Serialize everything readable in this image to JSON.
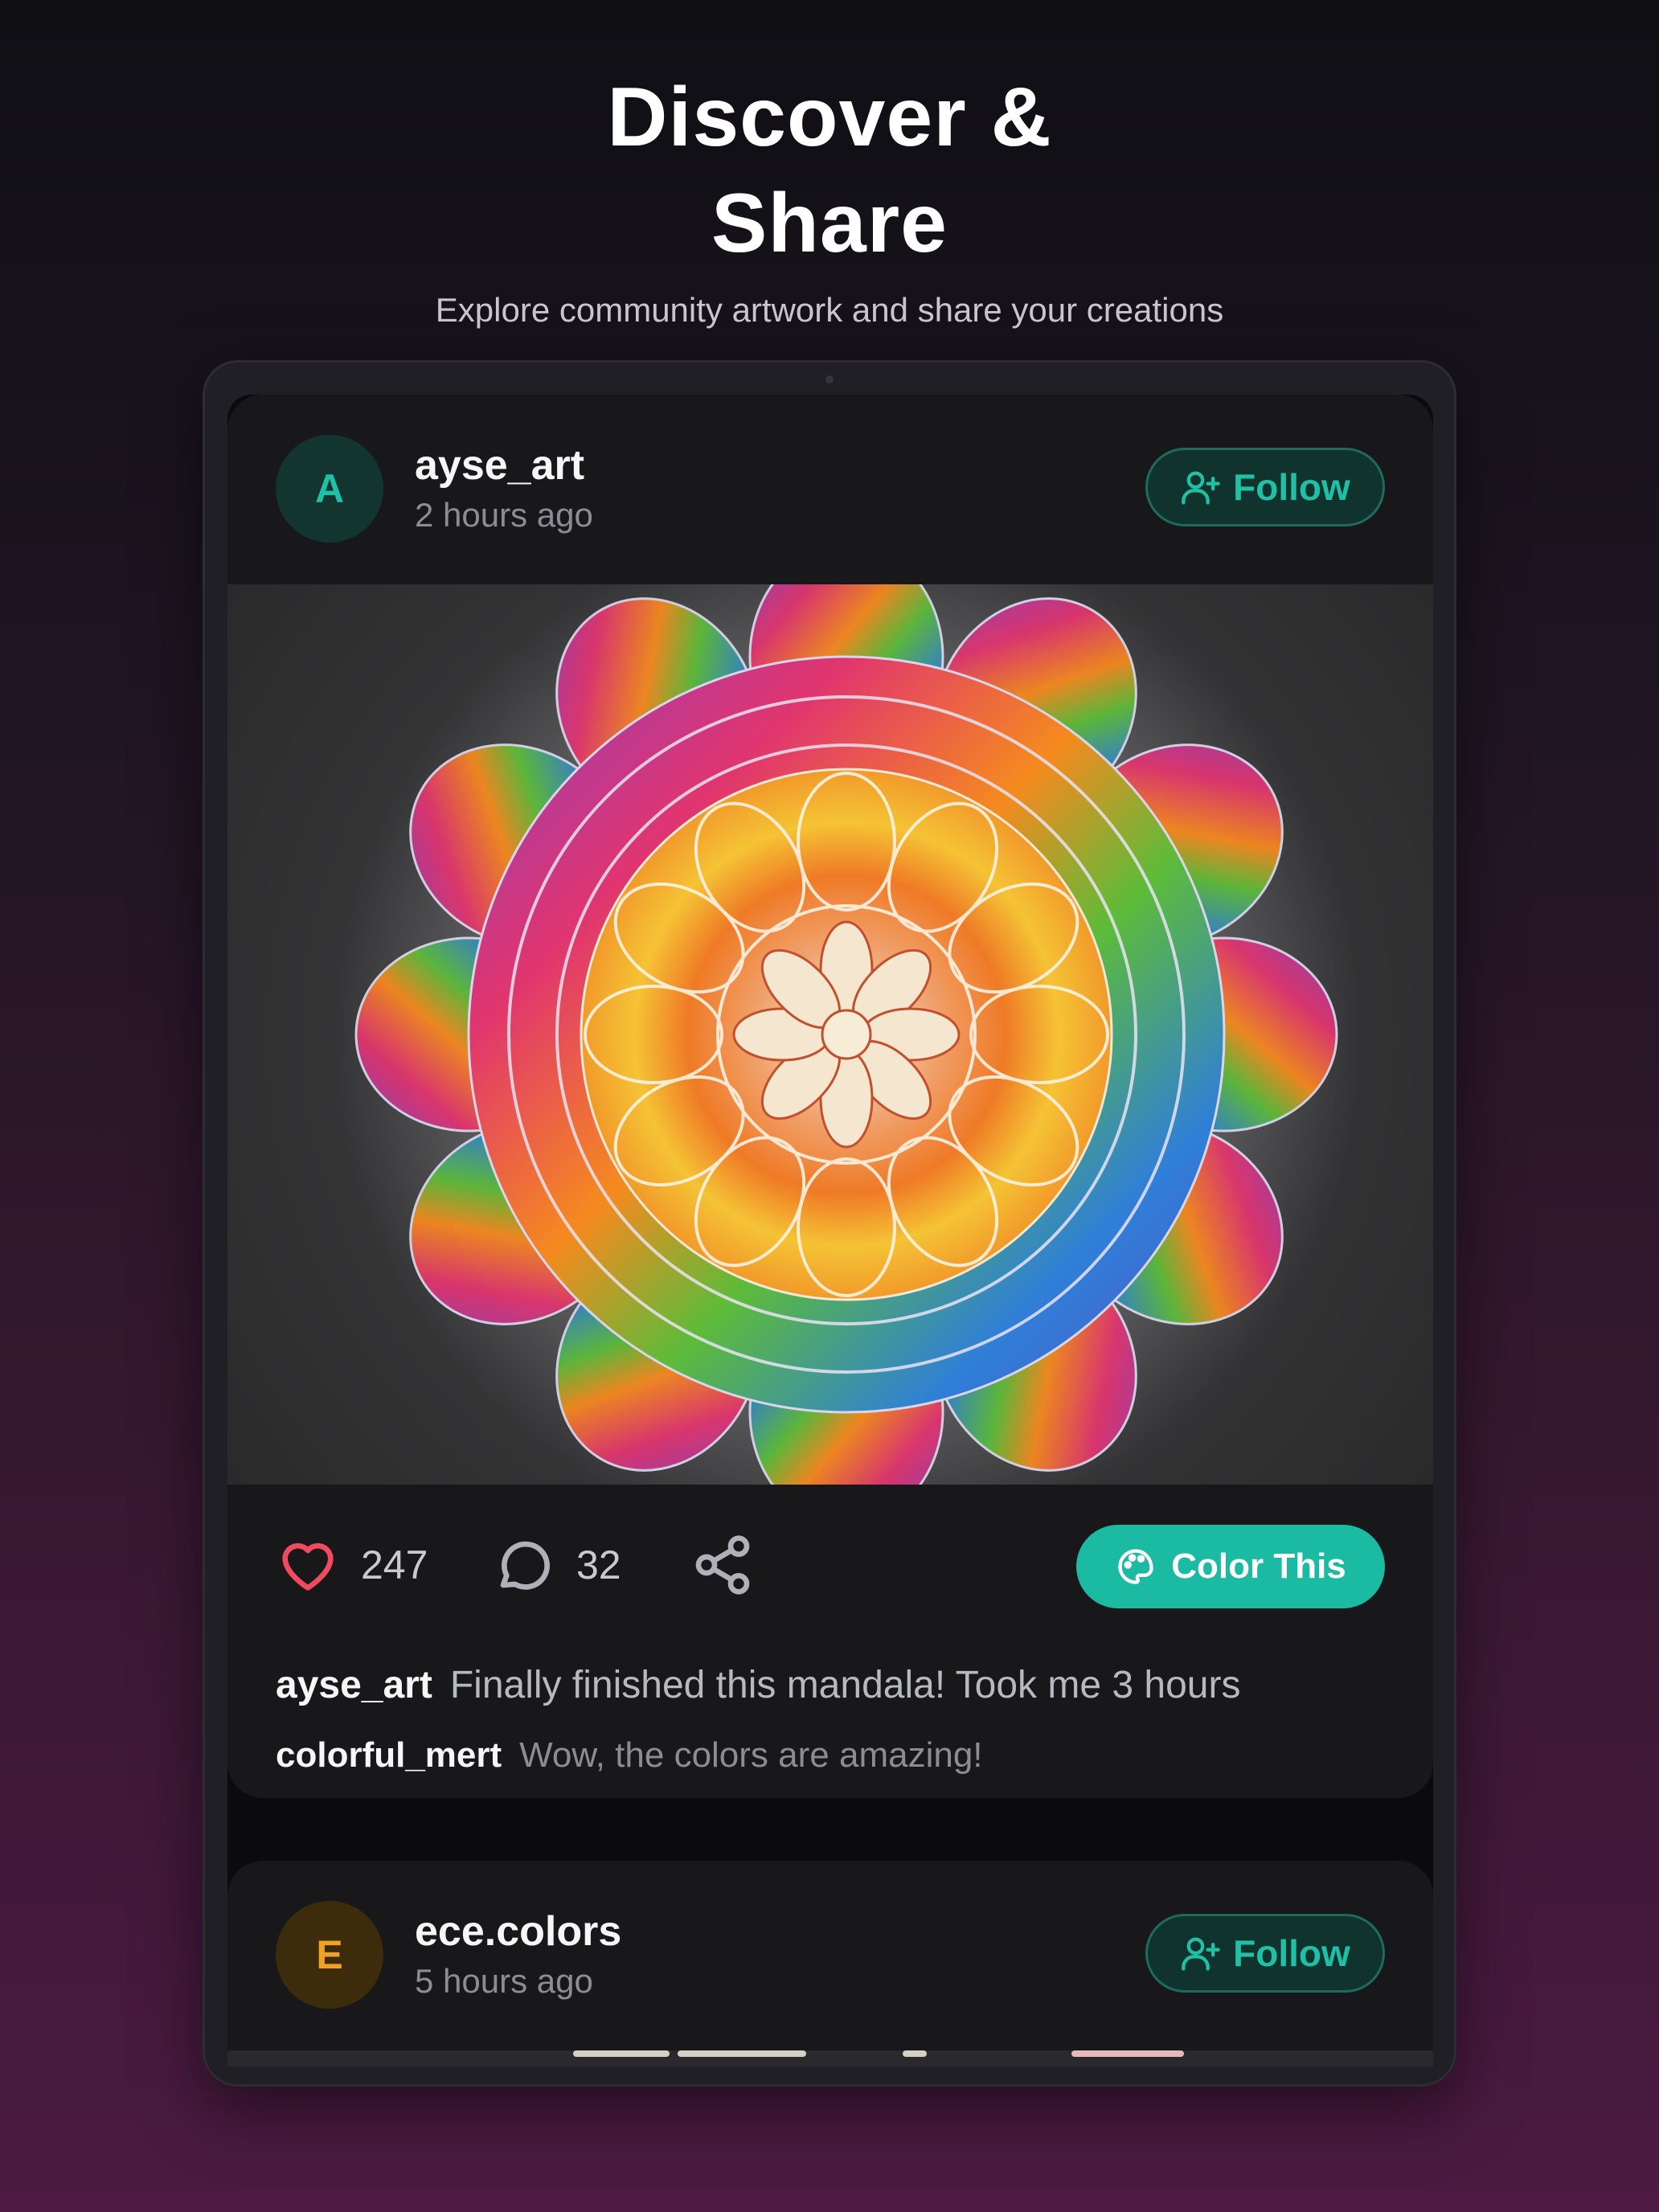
{
  "hero": {
    "title_line1": "Discover &",
    "title_line2": "Share",
    "subtitle": "Explore community artwork and share your creations"
  },
  "posts": [
    {
      "avatar_letter": "A",
      "username": "ayse_art",
      "time": "2 hours ago",
      "follow_label": "Follow",
      "artwork_icon": "mandala-artwork",
      "likes": "247",
      "comments": "32",
      "color_this_label": "Color This",
      "caption_user": "ayse_art",
      "caption_text": "Finally finished this mandala! Took me 3 hours",
      "comment_user": "colorful_mert",
      "comment_text": "Wow, the colors are amazing!"
    },
    {
      "avatar_letter": "E",
      "username": "ece.colors",
      "time": "5 hours ago",
      "follow_label": "Follow"
    }
  ],
  "colors": {
    "accent": "#1bbaa2",
    "like_heart": "#f04a5f",
    "background_top": "#0f0f14",
    "background_bottom": "#4c1a42"
  },
  "icons": {
    "follow": "user-plus-icon",
    "like": "heart-icon",
    "comment": "speech-bubble-icon",
    "share": "share-icon",
    "color_this": "palette-icon"
  }
}
